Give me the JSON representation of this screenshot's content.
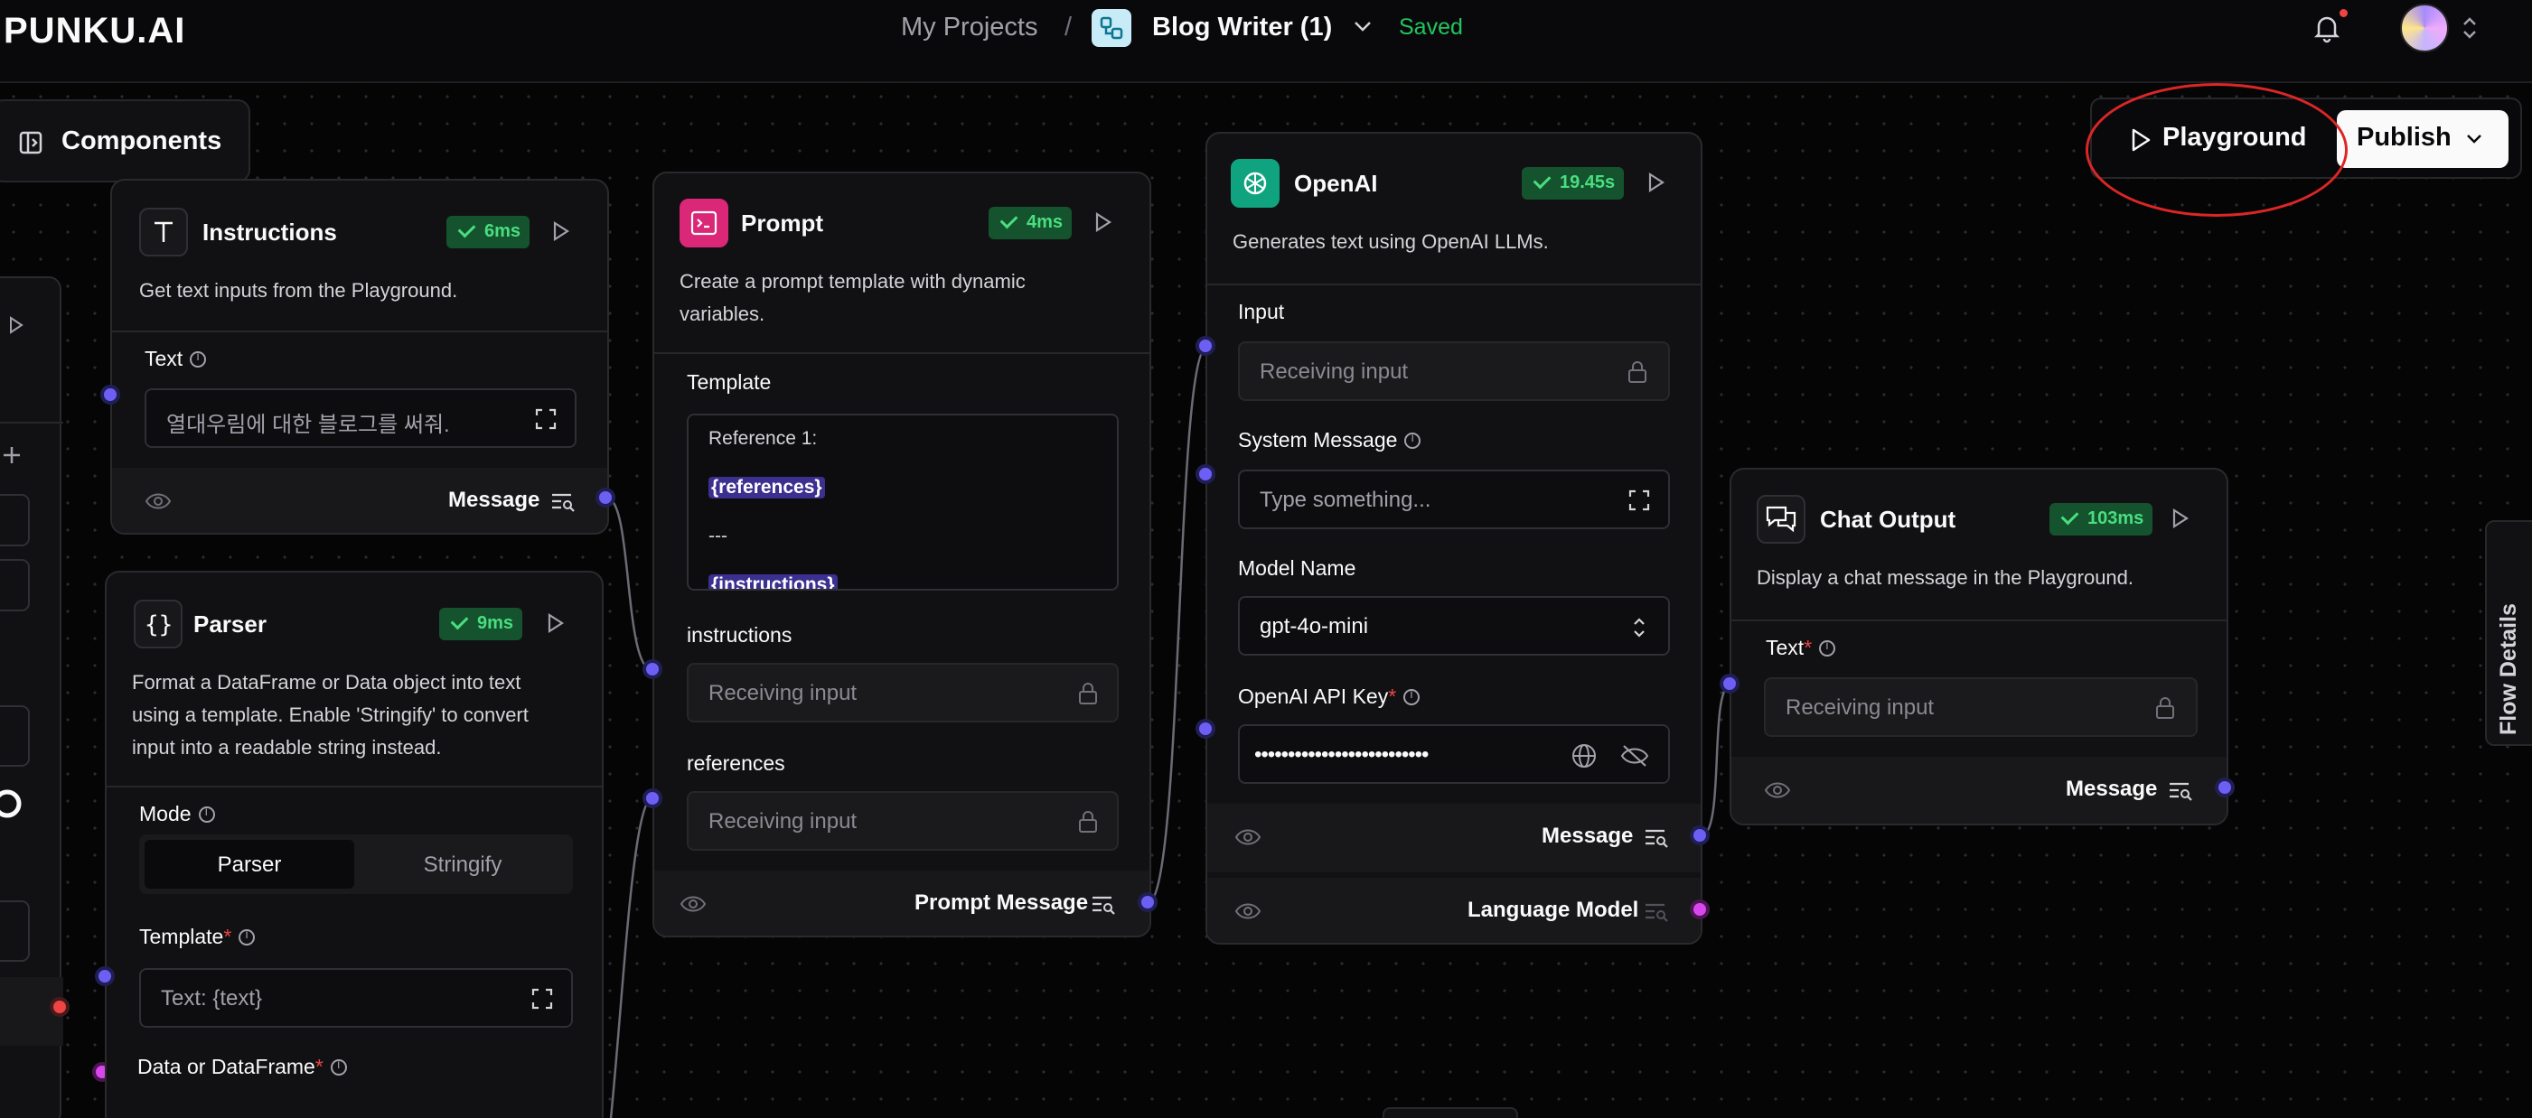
{
  "header": {
    "logo": "PUNKU.AI",
    "breadcrumb_projects": "My Projects",
    "breadcrumb_sep": "/",
    "flow_name": "Blog Writer (1)",
    "save_status": "Saved"
  },
  "toolbar": {
    "components_label": "Components",
    "playground_label": "Playground",
    "publish_label": "Publish",
    "flow_details_label": "Flow Details"
  },
  "nodes": {
    "instructions": {
      "title": "Instructions",
      "time": "6ms",
      "desc": "Get text inputs from the Playground.",
      "text_label": "Text",
      "text_value": "열대우림에 대한 블로그를 써줘.",
      "output": "Message"
    },
    "parser": {
      "title": "Parser",
      "time": "9ms",
      "desc": [
        "Format a DataFrame or Data object into text",
        "using a template. Enable 'Stringify' to convert",
        "input into a readable string instead."
      ],
      "mode_label": "Mode",
      "mode_options": [
        "Parser",
        "Stringify"
      ],
      "template_label": "Template",
      "template_value": "Text: {text}",
      "data_label": "Data or DataFrame"
    },
    "prompt": {
      "title": "Prompt",
      "time": "4ms",
      "desc": [
        "Create a prompt template with dynamic",
        "variables."
      ],
      "template_label": "Template",
      "template_lines": [
        "Reference 1:",
        "{references}",
        "---",
        "{instructions}"
      ],
      "instructions_label": "instructions",
      "instructions_value": "Receiving input",
      "references_label": "references",
      "references_value": "Receiving input",
      "output": "Prompt Message"
    },
    "openai": {
      "title": "OpenAI",
      "time": "19.45s",
      "desc": "Generates text using OpenAI LLMs.",
      "input_label": "Input",
      "input_value": "Receiving input",
      "system_label": "System Message",
      "system_placeholder": "Type something...",
      "model_label": "Model Name",
      "model_value": "gpt-4o-mini",
      "apikey_label": "OpenAI API Key",
      "apikey_value": "••••••••••••••••••••••••••",
      "output_message": "Message",
      "output_model": "Language Model"
    },
    "chat_output": {
      "title": "Chat Output",
      "time": "103ms",
      "desc": "Display a chat message in the Playground.",
      "text_label": "Text",
      "text_value": "Receiving input",
      "output": "Message"
    }
  },
  "colors": {
    "handle": "#6d5ff4",
    "badge_bg": "#14532d",
    "badge_fg": "#4ade80",
    "highlight": "#dc2626"
  }
}
